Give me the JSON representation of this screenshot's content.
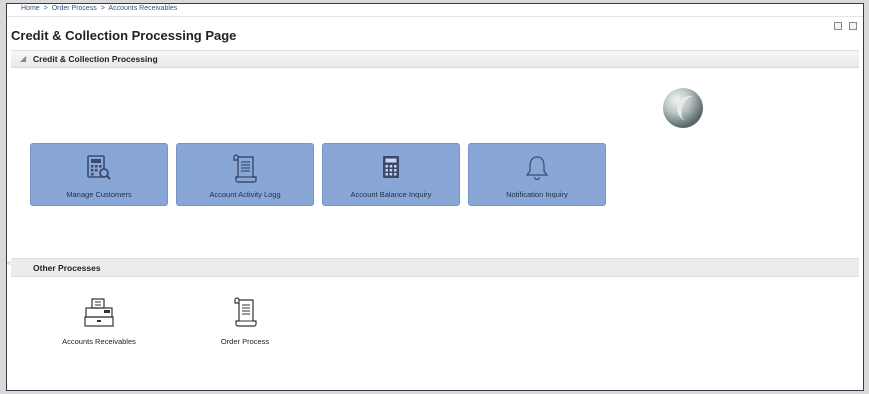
{
  "breadcrumb": [
    "Home",
    ">",
    "Order Process",
    ">",
    "Accounts Receivables"
  ],
  "page": {
    "title": "Credit & Collection Processing Page"
  },
  "sections": {
    "main": {
      "title": "Credit & Collection Processing"
    },
    "other": {
      "title": "Other Processes"
    }
  },
  "tiles": [
    {
      "label": "Manage Customers",
      "icon": "calculator-search-icon"
    },
    {
      "label": "Account Activity Logg",
      "icon": "scroll-document-icon"
    },
    {
      "label": "Account Balance Inquiry",
      "icon": "calculator-icon"
    },
    {
      "label": "Notification Inquiry",
      "icon": "bell-icon"
    }
  ],
  "other_processes": [
    {
      "label": "Accounts Receivables",
      "icon": "cash-register-icon"
    },
    {
      "label": "Order Process",
      "icon": "scroll-document-icon"
    }
  ],
  "colors": {
    "tile_bg": "#88a7d7",
    "tile_text": "#1f2f48",
    "icon_stroke": "#3b4a6b"
  }
}
